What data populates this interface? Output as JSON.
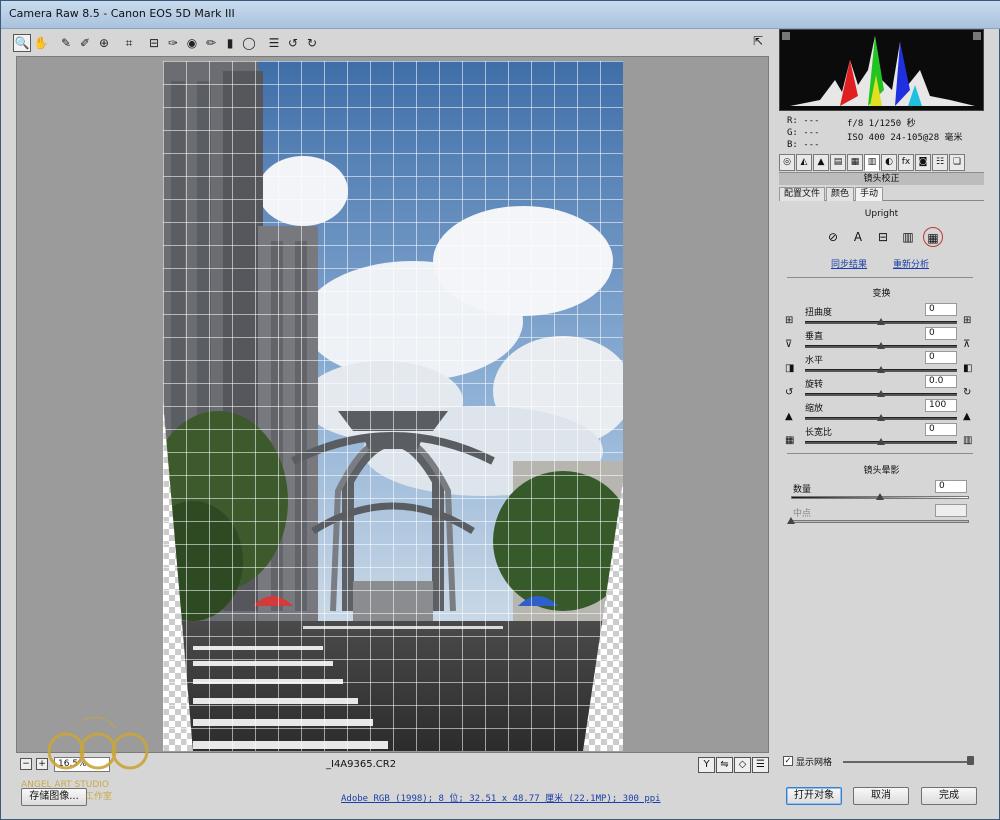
{
  "window": {
    "title": "Camera Raw 8.5 -  Canon EOS 5D Mark III",
    "minimize": "—",
    "maximize": "□",
    "close": "✕"
  },
  "toolbar": {
    "tools": [
      {
        "name": "zoom-tool-icon",
        "glyph": "🔍",
        "active": true
      },
      {
        "name": "hand-tool-icon",
        "glyph": "✋"
      },
      {
        "name": "white-balance-tool-icon",
        "glyph": "✎"
      },
      {
        "name": "color-sampler-tool-icon",
        "glyph": "✐"
      },
      {
        "name": "target-adjust-tool-icon",
        "glyph": "⊕"
      },
      {
        "name": "crop-tool-icon",
        "glyph": "⌗"
      },
      {
        "name": "straighten-tool-icon",
        "glyph": "⊟"
      },
      {
        "name": "spot-removal-tool-icon",
        "glyph": "✑"
      },
      {
        "name": "red-eye-tool-icon",
        "glyph": "◉"
      },
      {
        "name": "adjustment-brush-icon",
        "glyph": "✏"
      },
      {
        "name": "graduated-filter-icon",
        "glyph": "▮"
      },
      {
        "name": "radial-filter-icon",
        "glyph": "◯"
      },
      {
        "name": "preferences-icon",
        "glyph": "☰"
      },
      {
        "name": "rotate-left-icon",
        "glyph": "↺"
      },
      {
        "name": "rotate-right-icon",
        "glyph": "↻"
      }
    ],
    "fullscreen_glyph": "⇱"
  },
  "preview": {
    "filename": "_I4A9365.CR2",
    "zoom_value": "16.5%",
    "zoom_minus": "−",
    "zoom_plus": "+",
    "bottom_icons": [
      "Y",
      "⇋",
      "◇",
      "☰"
    ]
  },
  "info": {
    "r": "R:  ---",
    "g": "G:  ---",
    "b": "B:  ---",
    "aperture_shutter": "f/8   1/1250 秒",
    "iso_lens": "ISO 400  24-105@28 毫米"
  },
  "panel": {
    "tabs": [
      "◎",
      "◭",
      "▲",
      "▤",
      "▦",
      "▥",
      "◐",
      "fx",
      "◙",
      "☷",
      "❏"
    ],
    "active_tab": 5,
    "header": "镜头校正",
    "subtabs": [
      "配置文件",
      "颜色",
      "手动"
    ],
    "active_subtab": 2,
    "upright_label": "Upright",
    "upright_buttons": [
      "⊘",
      "A",
      "⊟",
      "▥",
      "▦"
    ],
    "upright_active": 4,
    "sync_link": "同步结果",
    "reanalyze_link": "重新分析",
    "transform_title": "变换",
    "transform_sliders": [
      {
        "label": "扭曲度",
        "value": "0",
        "pos": 0.5,
        "licon": "⊞",
        "ricon": "⊞"
      },
      {
        "label": "垂直",
        "value": "0",
        "pos": 0.5,
        "licon": "⊽",
        "ricon": "⊼"
      },
      {
        "label": "水平",
        "value": "0",
        "pos": 0.5,
        "licon": "◨",
        "ricon": "◧"
      },
      {
        "label": "旋转",
        "value": "0.0",
        "pos": 0.5,
        "licon": "↺",
        "ricon": "↻"
      },
      {
        "label": "缩放",
        "value": "100",
        "pos": 0.5,
        "licon": "▲",
        "ricon": "▲"
      },
      {
        "label": "长宽比",
        "value": "0",
        "pos": 0.5,
        "licon": "▦",
        "ricon": "▥"
      }
    ],
    "vignette_title": "镜头晕影",
    "vignette": [
      {
        "label": "数量",
        "value": "0",
        "pos": 0.5
      },
      {
        "label": "中点",
        "value": "",
        "pos": 0.0
      }
    ],
    "show_grid_label": "显示网格",
    "show_grid_checked": true
  },
  "footer": {
    "save_label": "存储图像...",
    "workflow_link": "Adobe RGB (1998); 8 位; 32.51 x 48.77 厘米 (22.1MP); 300 ppi",
    "open_label": "打开对象",
    "cancel_label": "取消",
    "done_label": "完成"
  },
  "watermark": {
    "text1": "ANGEL ART STUDIO",
    "text2": "金玉良缘摄影工作室"
  }
}
